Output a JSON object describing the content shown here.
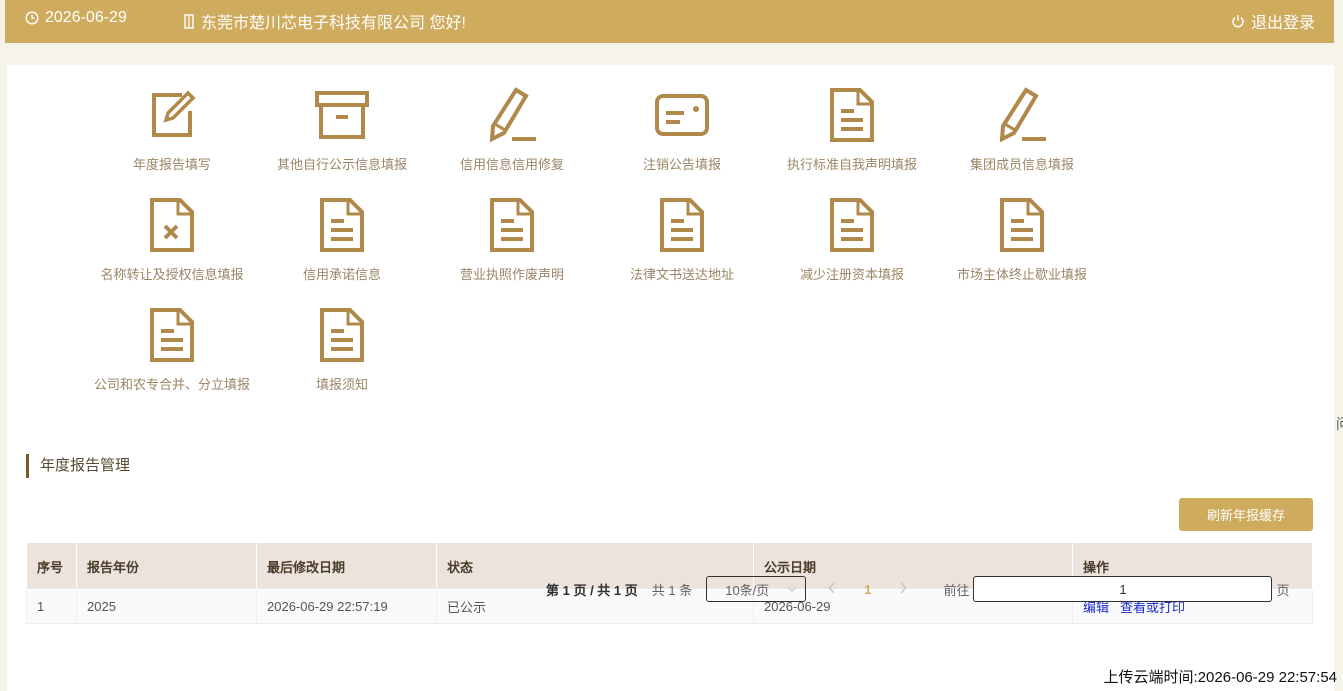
{
  "header": {
    "date": "2026-06-29",
    "greeting": "东莞市楚川芯电子科技有限公司 您好!",
    "logout_label": "退出登录"
  },
  "menu": [
    {
      "label": "年度报告填写",
      "icon": "edit-icon"
    },
    {
      "label": "其他自行公示信息填报",
      "icon": "archive-icon"
    },
    {
      "label": "信用信息信用修复",
      "icon": "pencil-icon"
    },
    {
      "label": "注销公告填报",
      "icon": "card-icon"
    },
    {
      "label": "执行标准自我声明填报",
      "icon": "document-icon"
    },
    {
      "label": "集团成员信息填报",
      "icon": "pencil-icon"
    },
    {
      "label": "名称转让及授权信息填报",
      "icon": "document-x-icon"
    },
    {
      "label": "信用承诺信息",
      "icon": "document-icon"
    },
    {
      "label": "营业执照作废声明",
      "icon": "document-icon"
    },
    {
      "label": "法律文书送达地址",
      "icon": "document-icon"
    },
    {
      "label": "减少注册资本填报",
      "icon": "document-icon"
    },
    {
      "label": "市场主体终止歇业填报",
      "icon": "document-icon"
    },
    {
      "label": "公司和农专合并、分立填报",
      "icon": "document-icon"
    },
    {
      "label": "填报须知",
      "icon": "document-icon"
    }
  ],
  "section": {
    "title": "年度报告管理"
  },
  "refresh_button": "刷新年报缓存",
  "table": {
    "headers": [
      "序号",
      "报告年份",
      "最后修改日期",
      "状态",
      "公示日期",
      "操作"
    ],
    "rows": [
      {
        "index": "1",
        "year": "2025",
        "modified": "2026-06-29 22:57:19",
        "status": "已公示",
        "publish_date": "2026-06-29",
        "actions": [
          "编辑",
          "查看或打印"
        ]
      }
    ]
  },
  "pagination": {
    "page_info": "第 1 页 / 共 1 页",
    "total": "共 1 条",
    "page_size": "10条/页",
    "current_page": "1",
    "goto_label": "前往",
    "goto_value": "1",
    "page_suffix": "页"
  },
  "upload_time": "上传云端时间:2026-06-29 22:57:54",
  "edge_glyph": "问",
  "colors": {
    "brand": "#cfab5e",
    "icon": "#b0894a",
    "link": "#1a2bcc",
    "header_bg": "#ebe3dc"
  }
}
